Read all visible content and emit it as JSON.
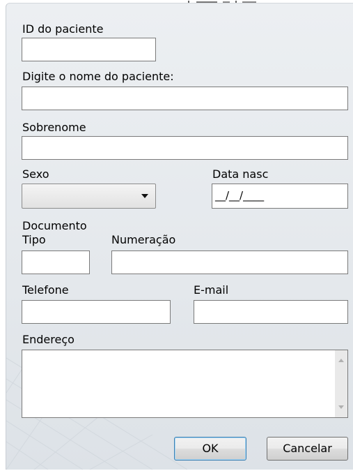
{
  "form": {
    "id_label": "ID do paciente",
    "id_value": "",
    "name_label": "Digite o nome do paciente:",
    "name_value": "",
    "surname_label": "Sobrenome",
    "surname_value": "",
    "sex_label": "Sexo",
    "sex_value": "",
    "birth_label": "Data nasc",
    "birth_value": "__/__/____",
    "document_label": "Documento",
    "doc_type_label": "Tipo",
    "doc_type_value": "",
    "doc_number_label": "Numeração",
    "doc_number_value": "",
    "phone_label": "Telefone",
    "phone_value": "",
    "email_label": "E-mail",
    "email_value": "",
    "address_label": "Endereço",
    "address_value": ""
  },
  "buttons": {
    "ok": "OK",
    "cancel": "Cancelar"
  },
  "icons": {
    "dropdown": "chevron-down-icon",
    "scroll_up": "scroll-up-arrow-icon",
    "scroll_down": "scroll-down-arrow-icon"
  }
}
